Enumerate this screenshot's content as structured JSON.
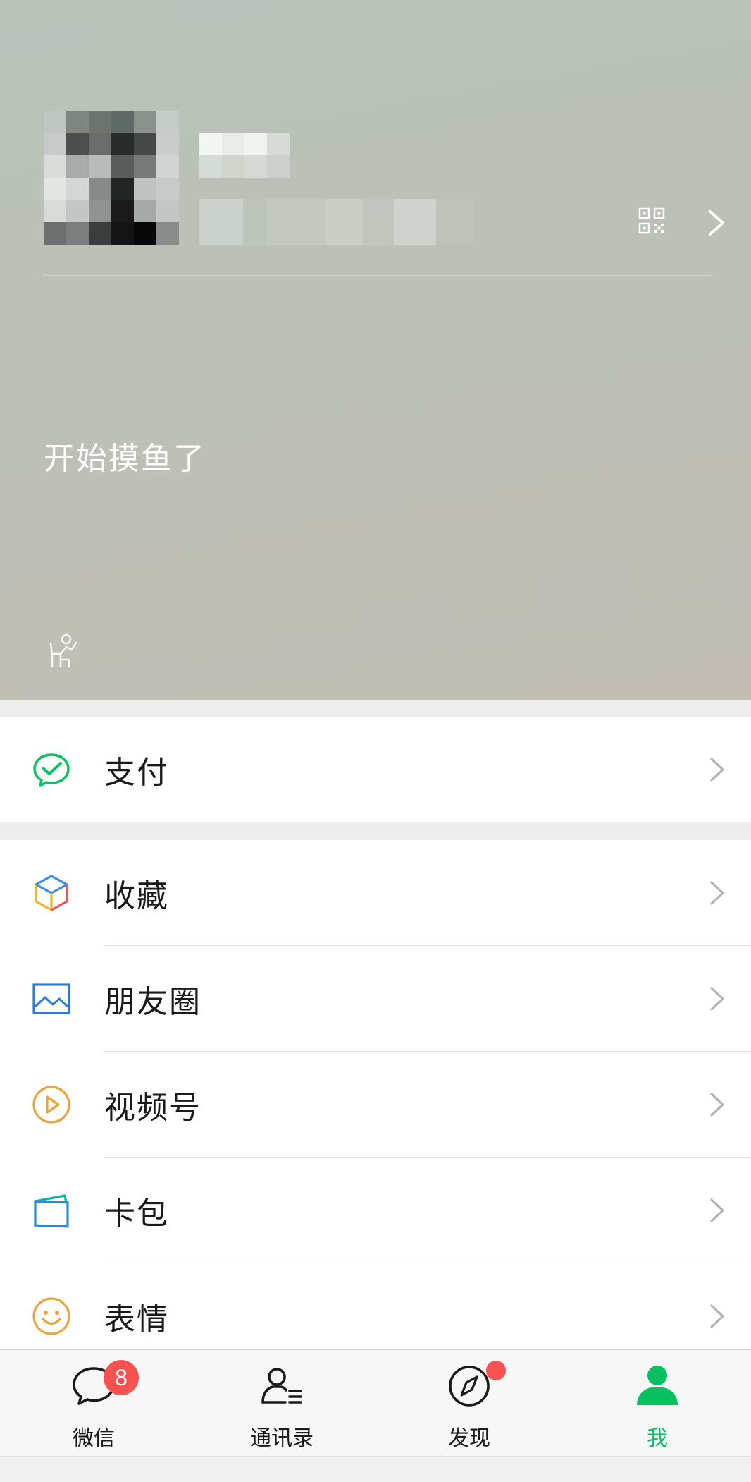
{
  "profile": {
    "status_text": "开始摸鱼了",
    "avatar_mosaic": [
      "#bfc6c2",
      "#7e867f",
      "#6e756f",
      "#5f6a66",
      "#8b918d",
      "#c5ccc7",
      "#c7cac8",
      "#4c4f4e",
      "#6a6d6c",
      "#2a2b2b",
      "#454746",
      "#c9ccca",
      "#d9dcd9",
      "#a8abaa",
      "#b8bbba",
      "#5a5c5b",
      "#787a79",
      "#d0d3d1",
      "#e3e5e3",
      "#d5d7d6",
      "#888a89",
      "#232424",
      "#c0c2c1",
      "#c8cbc9",
      "#d9dbd9",
      "#c4c6c5",
      "#909291",
      "#1a1a1a",
      "#a7a9a8",
      "#c2c7c5",
      "#6e706f",
      "#7b7d7c",
      "#3b3c3c",
      "#141414",
      "#080808",
      "#8a8c8b"
    ],
    "nickname_mosaic": [
      "#f2f5f1",
      "#e8ebe7",
      "#f0f2ef",
      "#d7dbd6",
      "#d5dcd7",
      "#cfd4cd",
      "#d4d9d3",
      "#cbd0ca"
    ],
    "wxid_mosaic": [
      "#cdd3cd",
      "#c4cac3",
      "#c6cbc5",
      "#d0d4cf",
      "#cdd1cc",
      "#c5cac4",
      "#d4d6d2",
      "#c2c7c1"
    ]
  },
  "menu": {
    "pay": {
      "label": "支付",
      "icon": "pay-icon"
    },
    "items": [
      {
        "label": "收藏",
        "icon": "favorites-icon"
      },
      {
        "label": "朋友圈",
        "icon": "moments-icon"
      },
      {
        "label": "视频号",
        "icon": "channels-icon"
      },
      {
        "label": "卡包",
        "icon": "cards-icon"
      },
      {
        "label": "表情",
        "icon": "stickers-icon"
      }
    ]
  },
  "tabbar": {
    "tabs": [
      {
        "label": "微信",
        "icon": "chat-icon",
        "badge": "8"
      },
      {
        "label": "通讯录",
        "icon": "contacts-icon"
      },
      {
        "label": "发现",
        "icon": "discover-icon",
        "dot": true
      },
      {
        "label": "我",
        "icon": "me-icon",
        "active": true
      }
    ]
  },
  "colors": {
    "accent_green": "#07c160",
    "badge_red": "#fa5151",
    "favorites_blue": "#3d8ee0",
    "favorites_red": "#e85858",
    "favorites_yellow": "#f0b429",
    "moments_blue": "#2a7bd1",
    "channels_orange": "#e8a33d",
    "cards_blue": "#2b8ad8",
    "cards_teal": "#12b5a3",
    "stickers_orange": "#e8a33d"
  }
}
